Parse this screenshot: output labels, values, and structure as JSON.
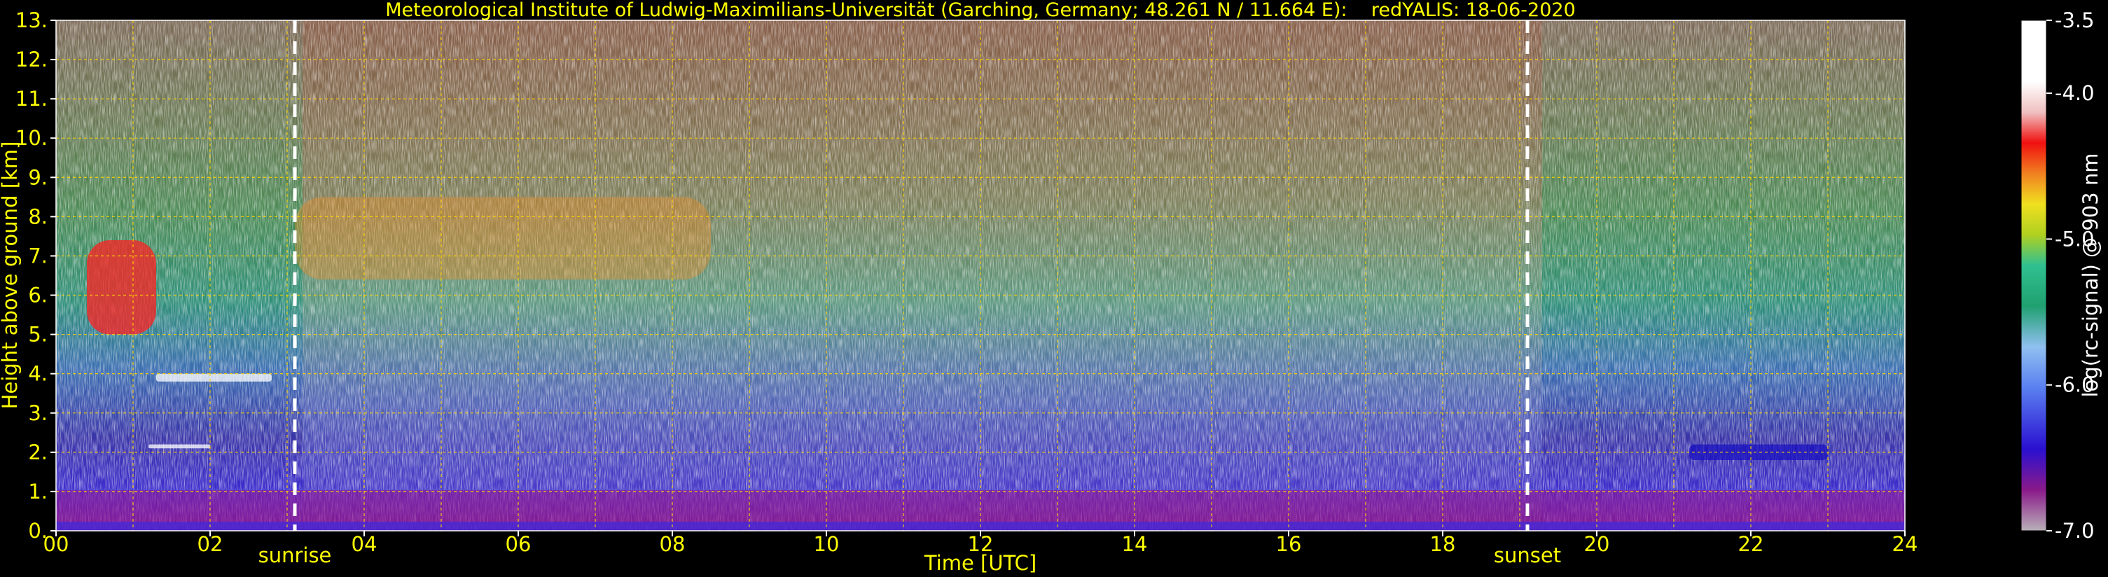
{
  "chart_data": {
    "type": "heatmap",
    "title": "Meteorological Institute of Ludwig-Maximilians-Universität (Garching, Germany; 48.261 N / 11.664 E):    redYALIS: 18-06-2020",
    "xlabel": "Time [UTC]",
    "ylabel": "Height above ground [km]",
    "xlim": [
      0,
      24
    ],
    "ylim": [
      0,
      13
    ],
    "x_ticks": [
      "00",
      "02",
      "04",
      "06",
      "08",
      "10",
      "12",
      "14",
      "16",
      "18",
      "20",
      "22",
      "24"
    ],
    "y_ticks": [
      "0.",
      "1.",
      "2.",
      "3.",
      "4.",
      "5.",
      "6.",
      "7.",
      "8.",
      "9.",
      "10.",
      "11.",
      "12.",
      "13."
    ],
    "grid": true,
    "events": [
      {
        "label": "sunrise",
        "time": 3.1
      },
      {
        "label": "sunset",
        "time": 19.1
      }
    ],
    "colorbar": {
      "label": "log(rc-signal) @ 903 nm",
      "range": [
        -7.0,
        -3.5
      ],
      "ticks": [
        "-3.5",
        "-4.0",
        "-5.0",
        "-6.0",
        "-7.0"
      ]
    },
    "cloud_features": [
      {
        "time_start": 0.4,
        "time_end": 1.3,
        "height_bottom": 5.0,
        "height_top": 7.4
      },
      {
        "time_start": 3.1,
        "time_end": 8.5,
        "height_bottom": 6.4,
        "height_top": 8.5
      },
      {
        "time_start": 1.3,
        "time_end": 2.8,
        "height_bottom": 3.8,
        "height_top": 4.0
      },
      {
        "time_start": 1.2,
        "time_end": 2.0,
        "height_bottom": 2.1,
        "height_top": 2.2
      },
      {
        "time_start": 21.2,
        "time_end": 23.0,
        "height_bottom": 1.8,
        "height_top": 2.2
      }
    ]
  }
}
